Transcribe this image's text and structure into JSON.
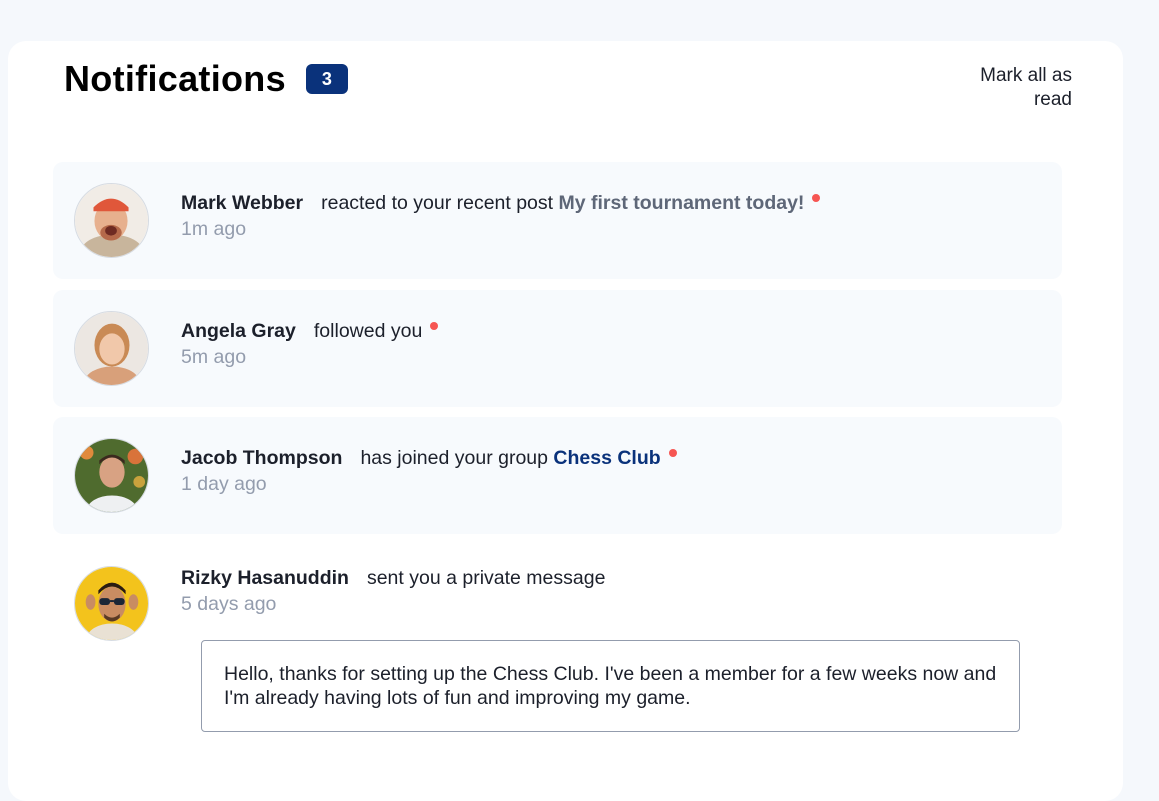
{
  "header": {
    "title": "Notifications",
    "unread_count": "3",
    "mark_all_label": "Mark all as read"
  },
  "notifications": [
    {
      "name": "Mark Webber",
      "action": "reacted to your recent post",
      "target": "My first tournament today!",
      "time": "1m ago",
      "unread": true,
      "avatar_icon": "avatar-mark-webber"
    },
    {
      "name": "Angela Gray",
      "action": "followed you",
      "target": "",
      "time": "5m ago",
      "unread": true,
      "avatar_icon": "avatar-angela-gray"
    },
    {
      "name": "Jacob Thompson",
      "action": "has joined your group",
      "target": "Chess Club",
      "time": "1 day ago",
      "unread": true,
      "avatar_icon": "avatar-jacob-thompson"
    },
    {
      "name": "Rizky Hasanuddin",
      "action": "sent you a private message",
      "target": "",
      "time": "5 days ago",
      "unread": false,
      "avatar_icon": "avatar-rizky-hasanuddin",
      "message": "Hello, thanks for setting up the Chess Club. I've been a member for a few weeks now and I'm already having lots of fun and improving my game."
    }
  ],
  "colors": {
    "accent": "#0a327b",
    "unread_dot": "#f65552",
    "unread_bg": "#f7fafd",
    "muted_text": "#939cad"
  }
}
